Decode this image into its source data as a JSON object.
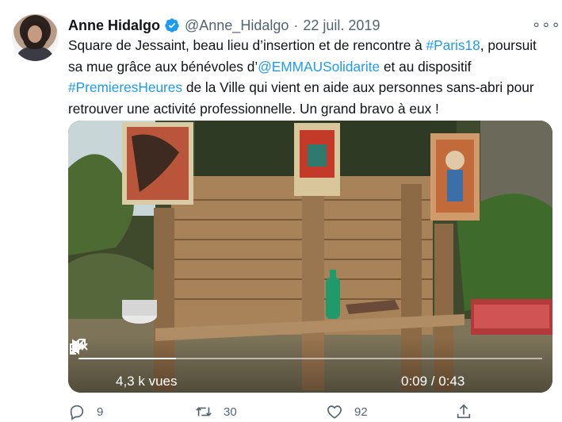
{
  "tweet": {
    "author_name": "Anne Hidalgo",
    "handle": "@Anne_Hidalgo",
    "separator": "·",
    "date": "22 juil. 2019",
    "more_label": "∘∘∘",
    "text_parts": {
      "p1": "Square de Jessaint, beau lieu d’insertion et de rencontre à ",
      "hashtag1": "#Paris18",
      "p2": ", poursuit sa mue grâce aux bénévoles d’",
      "mention": "@EMMAUSolidarite",
      "p3": " et au dispositif ",
      "hashtag2": "#PremieresHeures",
      "p4": " de la Ville qui vient en aide aux personnes sans-abri pour retrouver une activité professionnelle. Un grand bravo à eux !"
    }
  },
  "video": {
    "views": "4,3 k vues",
    "time": "0:09 / 0:43",
    "progress": 0.21
  },
  "actions": {
    "replies": "9",
    "retweets": "30",
    "likes": "92"
  },
  "colors": {
    "link": "#1d9bf0",
    "secondary_text": "#536471",
    "verified_badge": "#1d9bf0"
  },
  "icons": [
    "verified-badge-icon",
    "more-icon",
    "play-icon",
    "mute-icon",
    "fullscreen-icon",
    "reply-icon",
    "retweet-icon",
    "like-icon",
    "share-icon"
  ]
}
